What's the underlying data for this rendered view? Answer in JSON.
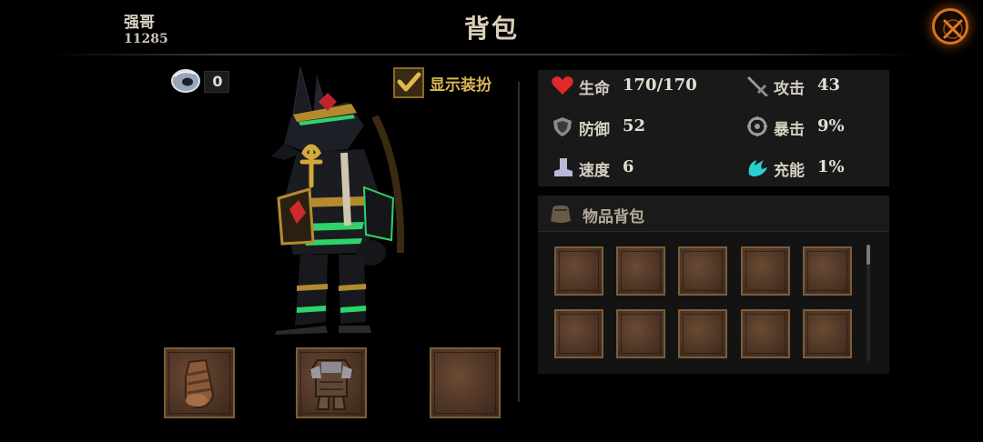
{
  "player": {
    "name": "强哥",
    "id": "11285"
  },
  "page": {
    "title": "背包"
  },
  "currency": {
    "value": "0",
    "icon": "ring-token-icon"
  },
  "costume_toggle": {
    "label": "显示装扮",
    "checked": true
  },
  "stats": [
    {
      "label": "生命",
      "value": "170/170",
      "icon": "heart-icon"
    },
    {
      "label": "攻击",
      "value": "43",
      "icon": "sword-icon"
    },
    {
      "label": "防御",
      "value": "52",
      "icon": "shield-icon"
    },
    {
      "label": "暴击",
      "value": "9%",
      "icon": "critical-icon"
    },
    {
      "label": "速度",
      "value": "6",
      "icon": "boot-icon"
    },
    {
      "label": "充能",
      "value": "1%",
      "icon": "energy-icon"
    }
  ],
  "equipment": {
    "slots": [
      {
        "item": "gauntlet",
        "icon": "gauntlet-icon"
      },
      {
        "item": "armor",
        "icon": "armor-icon"
      },
      {
        "item": null,
        "icon": ""
      }
    ]
  },
  "bag": {
    "title": "物品背包",
    "icon": "pouch-icon",
    "slot_count": 10
  },
  "colors": {
    "accent_gold": "#d9b656",
    "close_orange": "#d8721e",
    "slot_border": "#7a5e3a"
  }
}
